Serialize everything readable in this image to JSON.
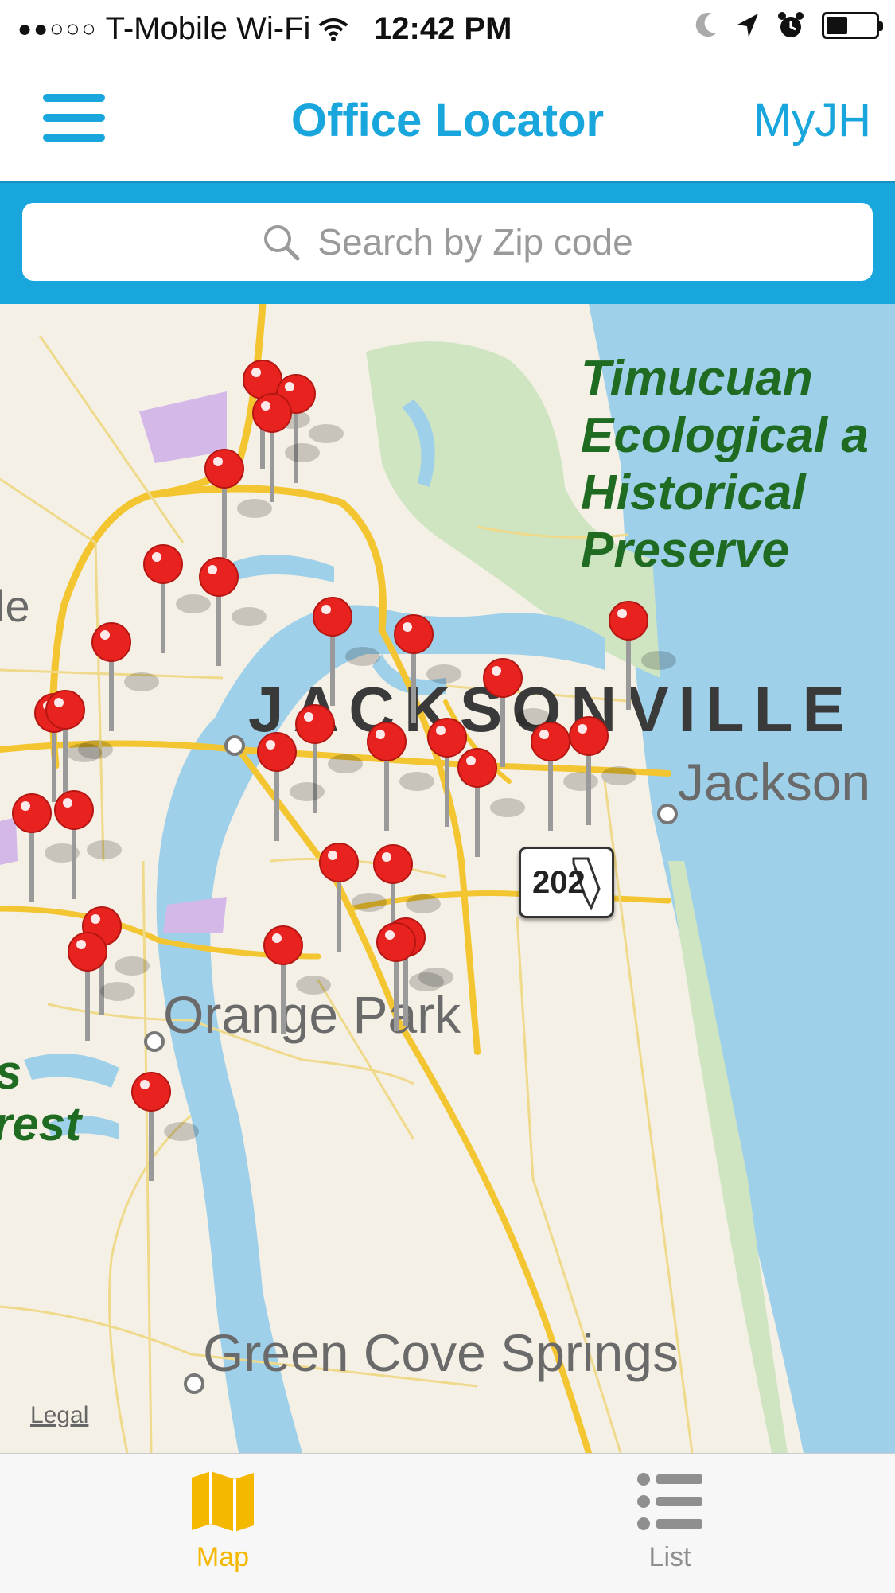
{
  "status_bar": {
    "signal_dots": "●●○○○",
    "carrier": "T-Mobile Wi-Fi",
    "time": "12:42 PM"
  },
  "nav": {
    "title": "Office Locator",
    "right_label": "MyJH"
  },
  "search": {
    "placeholder": "Search by Zip code"
  },
  "map": {
    "park_label": "Timucuan Ecological a Historical Preserve",
    "partial_left_label": "le",
    "forest_label_1": "s",
    "forest_label_2": "rest",
    "city_main": "JACKSONVILLE",
    "city_beach": "Jackson",
    "city_orange_park": "Orange Park",
    "city_green_cove": "Green Cove Springs",
    "road_shield": "202",
    "legal_link": "Legal",
    "pin_count": 30
  },
  "tabbar": {
    "tabs": [
      {
        "label": "Map",
        "icon": "map-icon",
        "selected": true
      },
      {
        "label": "List",
        "icon": "list-icon",
        "selected": false
      }
    ]
  },
  "colors": {
    "accent": "#19a6dc",
    "tab_selected": "#f5b800",
    "pin": "#e8231f",
    "water": "#9fd0ea",
    "land": "#f5f0e6",
    "park_text": "#1f6b21"
  }
}
